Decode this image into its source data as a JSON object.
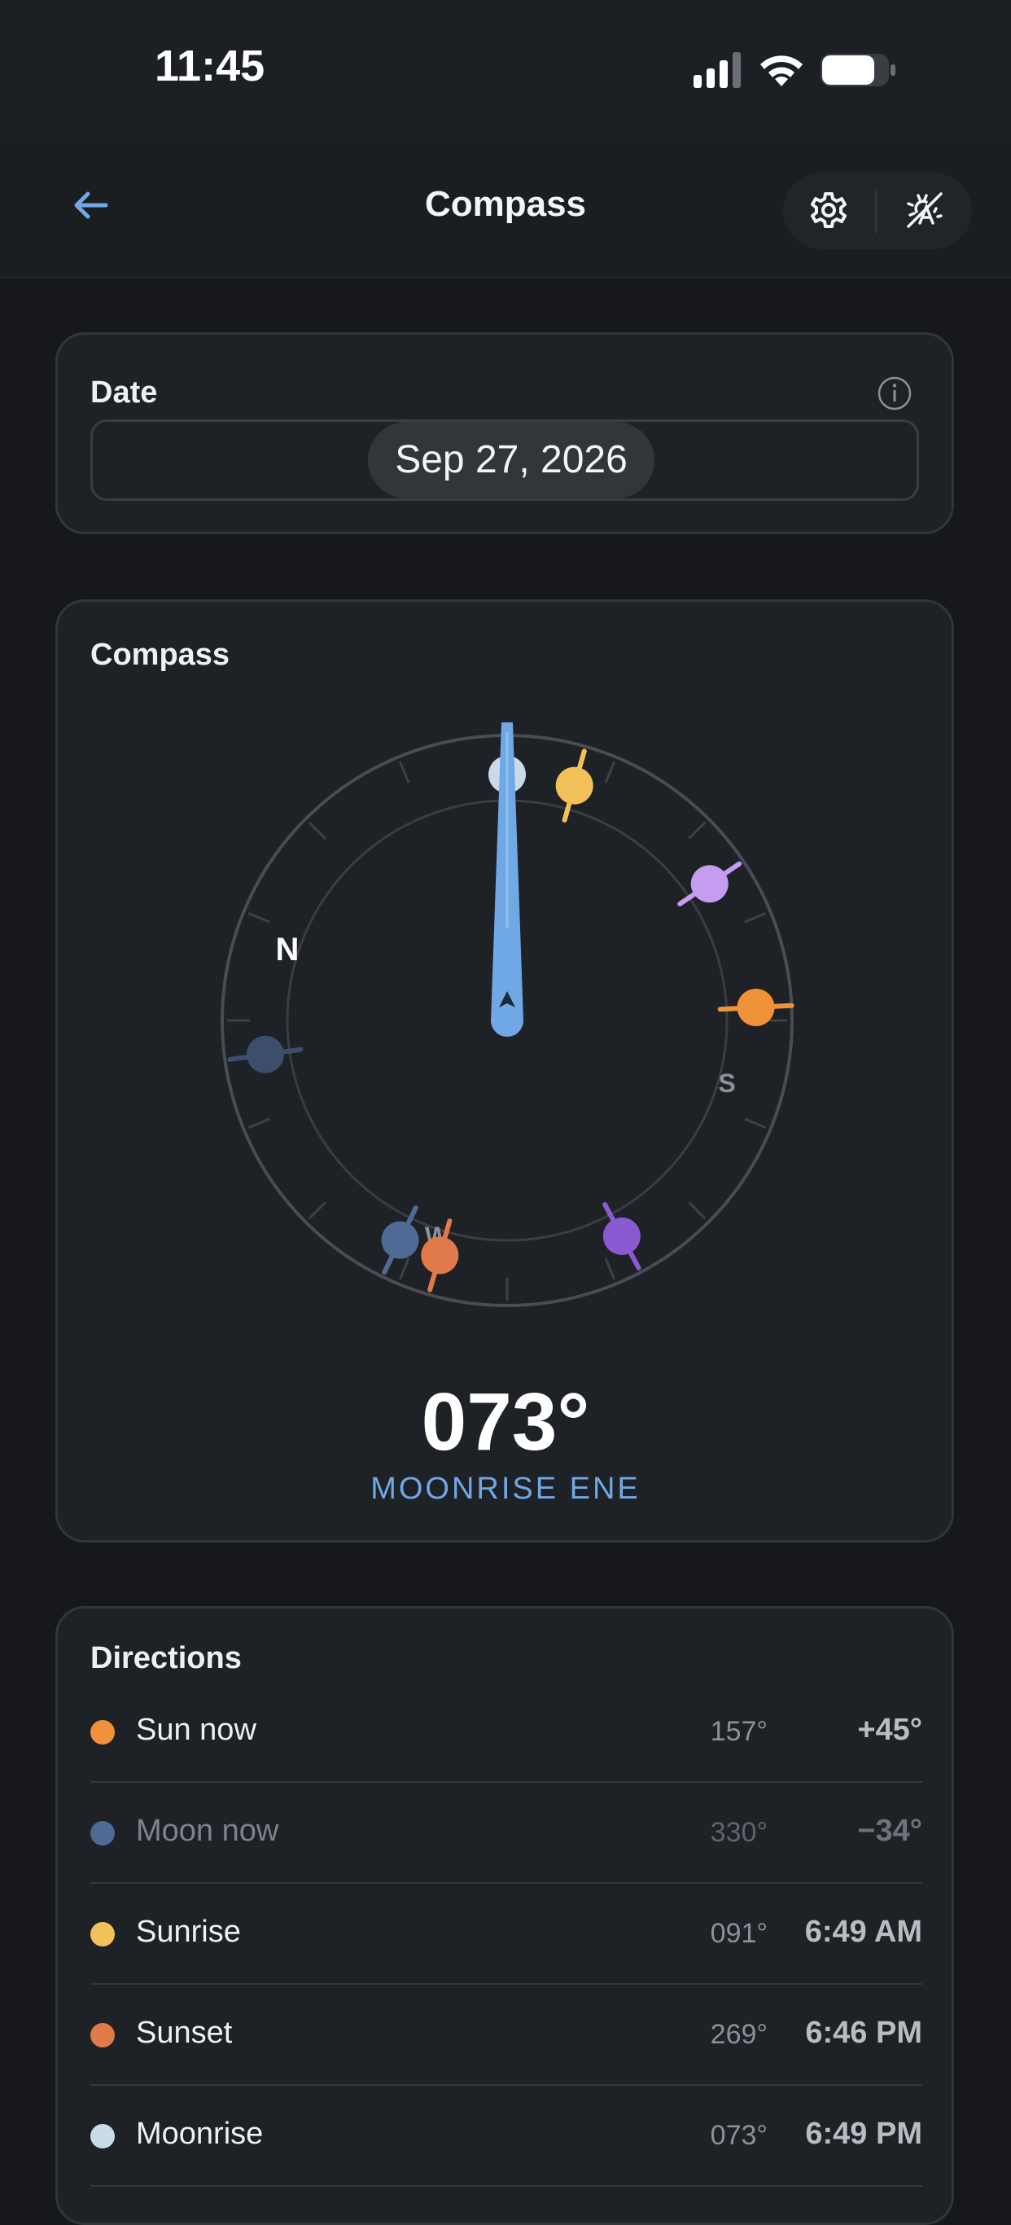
{
  "status_bar": {
    "time": "11:45"
  },
  "header": {
    "title": "Compass"
  },
  "date_card": {
    "label": "Date",
    "value": "Sep 27, 2026"
  },
  "compass": {
    "label": "Compass",
    "cardinal": {
      "n": "N",
      "s": "S",
      "w": "W"
    },
    "heading_value": "073°",
    "heading_label": "MOONRISE ENE"
  },
  "directions": {
    "title": "Directions",
    "rows": [
      {
        "name": "Sun now",
        "degree": "157°",
        "value": "+45°",
        "color": "#f0923a"
      },
      {
        "name": "Moon now",
        "degree": "330°",
        "value": "−34°",
        "color": "#4f6a94"
      },
      {
        "name": "Sunrise",
        "degree": "091°",
        "value": "6:49 AM",
        "color": "#f2c25a"
      },
      {
        "name": "Sunset",
        "degree": "269°",
        "value": "6:46 PM",
        "color": "#e07a4a"
      },
      {
        "name": "Moonrise",
        "degree": "073°",
        "value": "6:49 PM",
        "color": "#c9dbe8"
      }
    ]
  },
  "colors": {
    "accent": "#6fa8e4",
    "background": "#16181b",
    "card": "#1e2125",
    "sun": "#f0923a",
    "moon": "#4f6a94",
    "sunrise": "#f2c25a",
    "sunset": "#e07a4a",
    "moonrise": "#c9dbe8",
    "lilac": "#c49cf0",
    "violet": "#8a5ad0"
  },
  "icons": {
    "back": "arrow-left-icon",
    "settings": "gear-icon",
    "auto": "auto-brightness-off-icon",
    "info": "info-icon"
  }
}
